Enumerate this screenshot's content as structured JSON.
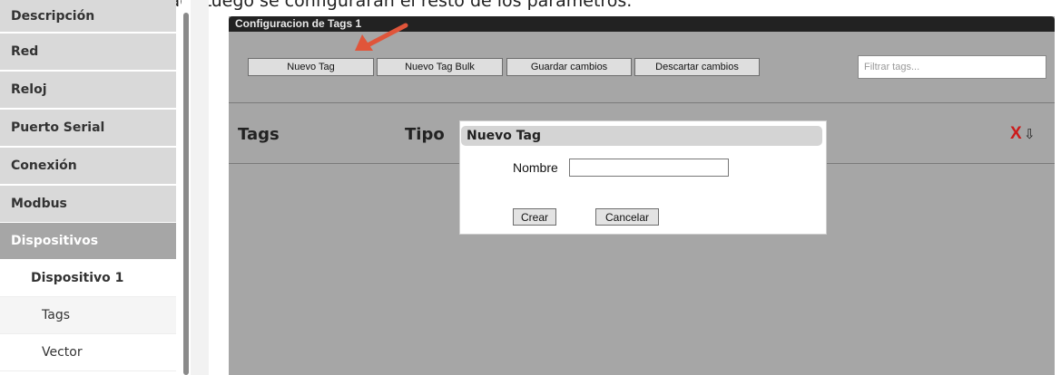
{
  "caption": "nombre del nuevo tag. Luego se configurarán el resto de los parámetros.",
  "sidebar": {
    "items": [
      {
        "label": "Descripción"
      },
      {
        "label": "Red"
      },
      {
        "label": "Reloj"
      },
      {
        "label": "Puerto Serial"
      },
      {
        "label": "Conexión"
      },
      {
        "label": "Modbus"
      },
      {
        "label": "Dispositivos"
      }
    ],
    "device": "Dispositivo 1",
    "subitems": [
      {
        "label": "Tags"
      },
      {
        "label": "Vector"
      }
    ]
  },
  "panel": {
    "title": "Configuracion de Tags 1",
    "buttons": [
      "Nuevo Tag",
      "Nuevo Tag Bulk",
      "Guardar cambios",
      "Descartar cambios"
    ],
    "filter_placeholder": "Filtrar tags...",
    "columns": [
      "Tags",
      "Tipo"
    ],
    "delete_symbol": "X",
    "sort_symbol": "⇩"
  },
  "dialog": {
    "title": "Nuevo Tag",
    "name_label": "Nombre",
    "name_value": "",
    "create_label": "Crear",
    "cancel_label": "Cancelar"
  },
  "colors": {
    "sidebar_bg": "#d9d9d9",
    "sidebar_active": "#a6a6a6",
    "panel_bg": "#a6a6a6",
    "title_bar": "#222222",
    "delete_red": "#cc1a1a",
    "arrow": "#e0553a"
  }
}
